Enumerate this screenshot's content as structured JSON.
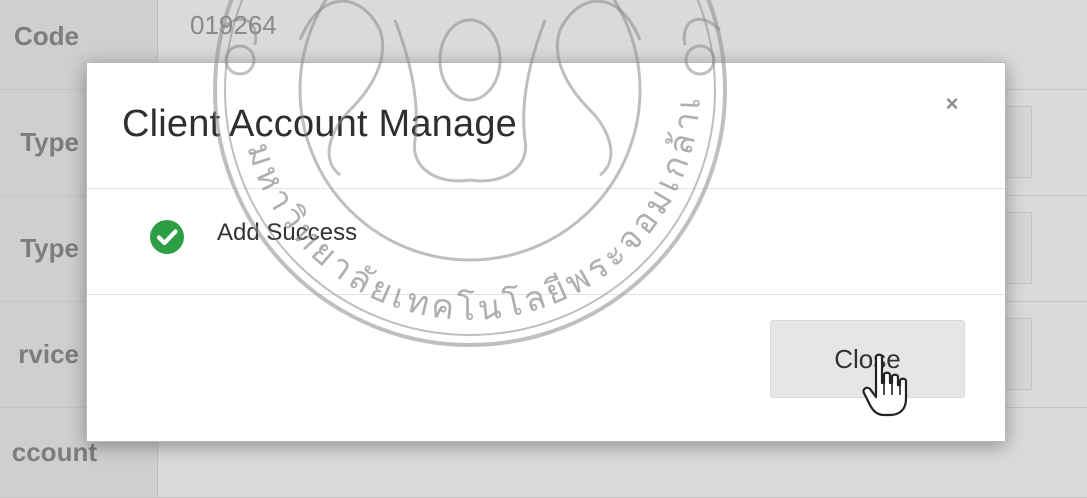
{
  "background_form": {
    "rows": [
      {
        "label": "Code",
        "value": "019264"
      },
      {
        "label": "Type",
        "value": ""
      },
      {
        "label": "Type",
        "value": ""
      },
      {
        "label": "rvice",
        "value": ""
      },
      {
        "label": "ccount",
        "value": ""
      }
    ]
  },
  "modal": {
    "title": "Client Account Manage",
    "close_glyph": "×",
    "message": "Add Success",
    "message_icon": "check-circle-icon",
    "close_button_label": "Close"
  },
  "watermark": {
    "type": "university-seal",
    "text": "มหาวิทยาลัยเทคโนโลยีพระจอมเกล้าเจ้าคุณทหารลาดกระบัง"
  },
  "colors": {
    "success_green": "#2e9e44",
    "overlay_gray": "#d8d8d8",
    "button_bg": "#e6e6e6"
  }
}
